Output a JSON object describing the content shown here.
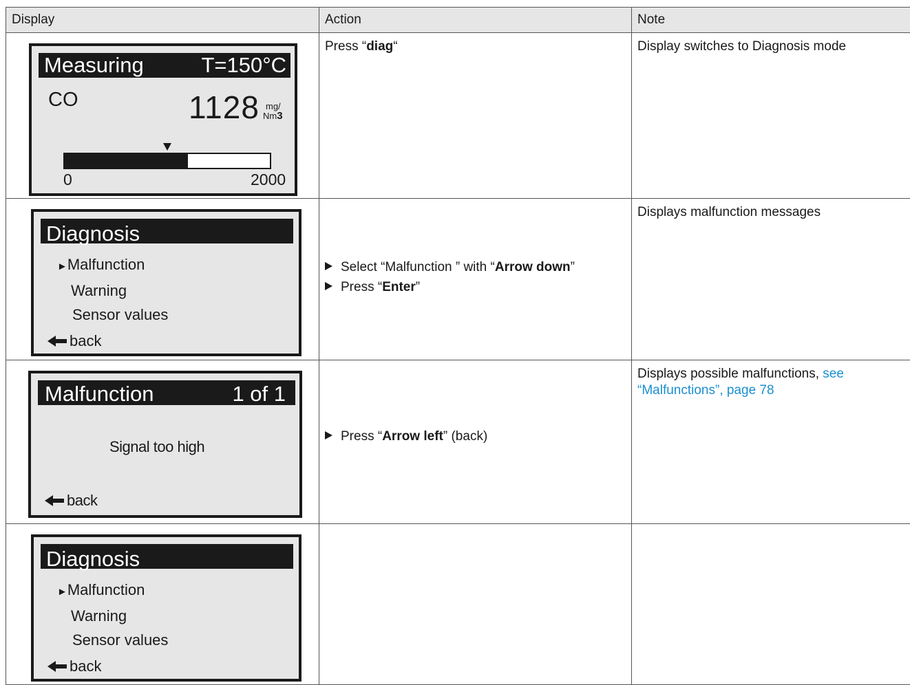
{
  "headers": {
    "display": "Display",
    "action": "Action",
    "note": "Note"
  },
  "rows": [
    {
      "screen": {
        "title": "Measuring",
        "temp": "T=150°C",
        "component": "CO",
        "value": "1128",
        "unit_top": "mg/",
        "unit_bottom": "Nm",
        "unit_exp": "3",
        "scale_min": "0",
        "scale_max": "2000",
        "bar_fill_fraction": 0.6
      },
      "action": {
        "prefix": "Press “",
        "key": "diag",
        "suffix": "“"
      },
      "note": "Display switches to Diagnosis mode"
    },
    {
      "screen": {
        "title": "Diagnosis",
        "items": [
          "Malfunction",
          "Warning",
          "Sensor values"
        ],
        "back": "back"
      },
      "action": {
        "line1_prefix": "Select “Malfunction ” with “",
        "line1_key": "Arrow down",
        "line1_suffix": "”",
        "line2_prefix": "Press “",
        "line2_key": "Enter",
        "line2_suffix": "”"
      },
      "note": "Displays malfunction messages"
    },
    {
      "screen": {
        "title": "Malfunction",
        "counter": "1 of 1",
        "message": "Signal too high",
        "back": "back"
      },
      "action": {
        "prefix": "Press “",
        "key": "Arrow left",
        "suffix": "” (back)"
      },
      "note": {
        "text": "Displays possible malfunctions, ",
        "link": "see “Malfunctions”, page 78"
      }
    },
    {
      "screen": {
        "title": "Diagnosis",
        "items": [
          "Malfunction",
          "Warning",
          "Sensor values"
        ],
        "back": "back"
      }
    }
  ]
}
